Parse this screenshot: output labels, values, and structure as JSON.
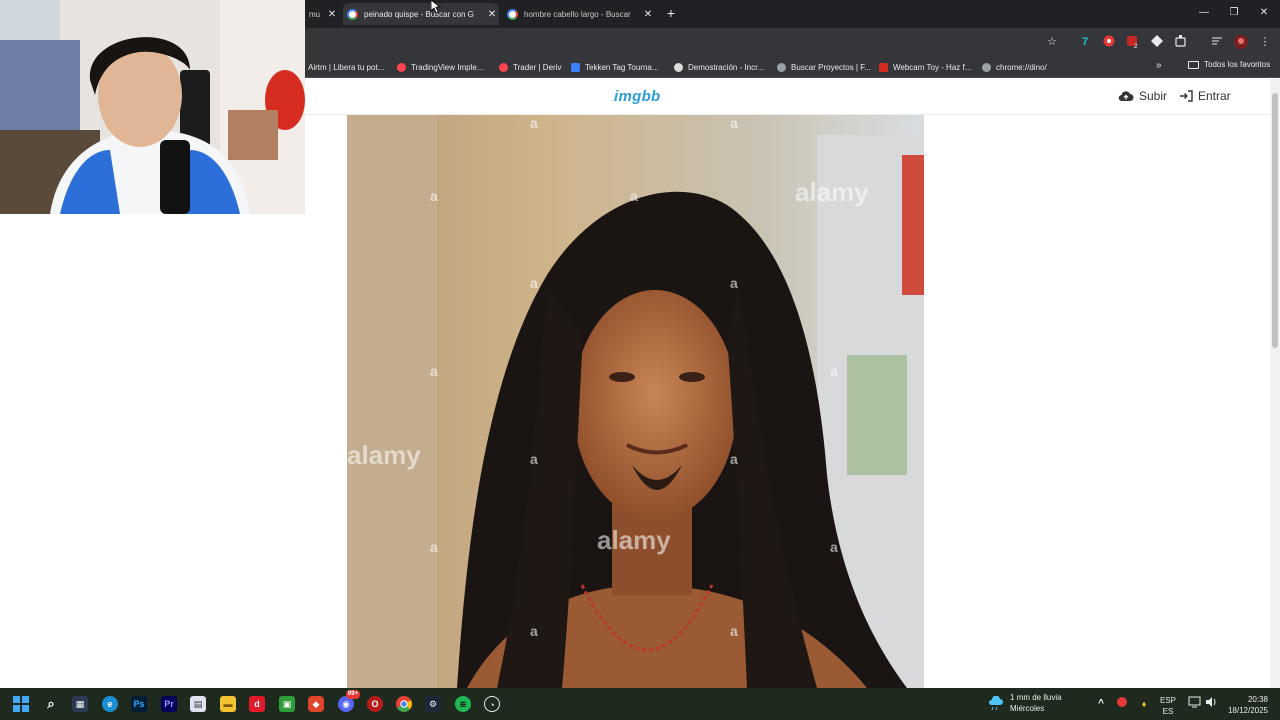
{
  "tabs": [
    {
      "title": "mu",
      "active": false
    },
    {
      "title": "peinado quispe - Buscar con G",
      "active": true
    },
    {
      "title": "hombre cabello largo - Buscar",
      "active": false
    }
  ],
  "tab_close_glyph": "✕",
  "bookmarks": [
    {
      "label": "Airtm | Libera tu pot...",
      "icon": "airtm-icon",
      "color": "#2b6cb0"
    },
    {
      "label": "TradingView Imple...",
      "icon": "deriv-icon",
      "color": "#ff444f"
    },
    {
      "label": "Trader | Deriv",
      "icon": "deriv-icon",
      "color": "#ff444f"
    },
    {
      "label": "Tekken Tag Tourna...",
      "icon": "tekken-icon",
      "color": "#3b82f6"
    },
    {
      "label": "Demostración - Incr...",
      "icon": "incr-icon",
      "color": "#dcdcdc"
    },
    {
      "label": "Buscar Proyectos | F...",
      "icon": "globe-icon",
      "color": "#9aa0a6"
    },
    {
      "label": "Webcam Toy - Haz f...",
      "icon": "webcam-toy-icon",
      "color": "#d62d20"
    },
    {
      "label": "chrome://dino/",
      "icon": "globe-icon",
      "color": "#9aa0a6"
    }
  ],
  "bookmarks_all": "Todos los favoritos",
  "site": {
    "logo": "imgbb",
    "upload_label": "Subir",
    "login_label": "Entrar"
  },
  "photo": {
    "watermark": "alamy",
    "watermark_small": "a"
  },
  "taskbar": {
    "weather_line1": "1 mm de lluvia",
    "weather_line2": "Miércoles",
    "lang_line1": "ESP",
    "lang_line2": "ES",
    "time": "20:38",
    "date": "18/12/2025",
    "discord_badge": "99+"
  },
  "colors": {
    "accent": "#2a9fd6",
    "tab_strip": "#202124",
    "toolbar": "#35363a"
  }
}
